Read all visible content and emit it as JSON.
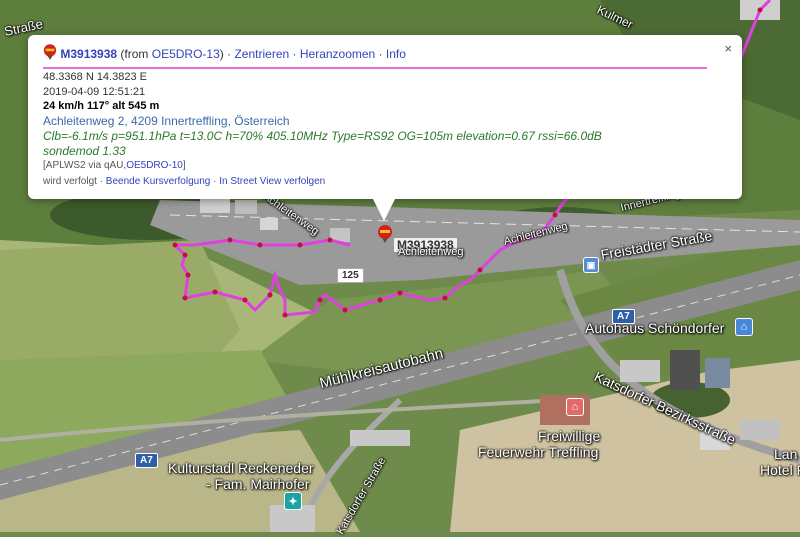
{
  "map": {
    "labels": {
      "street_top_left": "Straße",
      "street_top_right": "Kulmer",
      "achleitenweg_1": "Achleitenweg",
      "achleitenweg_2": "Achleitenweg",
      "achleitenweg_3": "Achleitenweg",
      "innertreffling": "Innertreffling",
      "freistaedter": "Freistädter Straße",
      "muehlkreis": "Mühlkreisautobahn",
      "katsdorfer_bezirk": "Katsdorfer Bezirksstraße",
      "katsdorfer_lower": "Katsdorfer Straße",
      "autohaus": "Autohaus Schöndorfer",
      "feuerwehr_1": "Freiwillige",
      "feuerwehr_2": "Feuerwehr Treffling",
      "kulturstadl_1": "Kulturstadl Reckeneder",
      "kulturstadl_2": "- Fam. Mairhofer",
      "lan_1": "Lan",
      "lan_2": "Hotel F"
    },
    "badges": {
      "a7_top": "A7",
      "a7_left": "A7",
      "road_125": "125"
    },
    "station_label": "M3913938",
    "track_color": "#e040e0"
  },
  "popup": {
    "callsign": "M3913938",
    "from_prefix": "(from",
    "from_station": "OE5DRO-13",
    "from_suffix": ")",
    "sep1": "·",
    "link_center": "Zentrieren",
    "sep2": "·",
    "link_zoom": "Heranzoomen",
    "sep3": "·",
    "link_info": "Info",
    "close": "×",
    "coords": "48.3368 N 14.3823 E",
    "timestamp": "2019-04-09 12:51:21",
    "motion": "24 km/h 117° alt 545 m",
    "address": "Achleitenweg 2, 4209 Innertreffling, Österreich",
    "comment_1": "Clb=-6.1m/s p=951.1hPa t=13.0C h=70% 405.10MHz Type=RS92 OG=105m elevation=0.67 rssi=66.0dB",
    "comment_2": "sondemod 1.33",
    "path_prefix": "[APLWS2 via qAU,",
    "path_station": "OE5DRO-10",
    "path_suffix": "]",
    "tracked_text": "wird verfolgt ·",
    "link_stop_tracking": "Beende Kursverfolgung",
    "sep4": "·",
    "link_streetview": "In Street View verfolgen"
  }
}
